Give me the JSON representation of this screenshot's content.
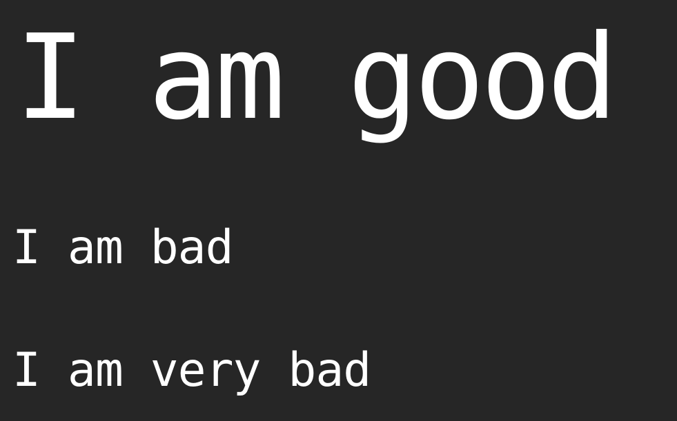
{
  "lines": [
    {
      "text": "I am good"
    },
    {
      "text": "I am bad"
    },
    {
      "text": "I am very bad"
    }
  ],
  "colors": {
    "background": "#262626",
    "text": "#ffffff"
  }
}
